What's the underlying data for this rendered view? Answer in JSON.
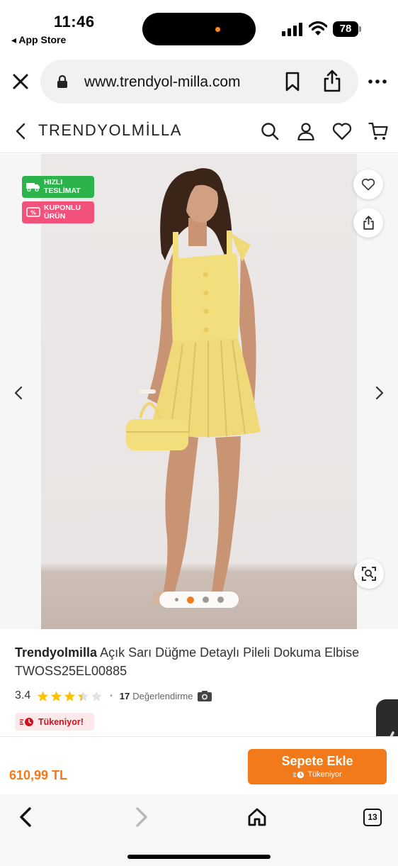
{
  "status_bar": {
    "time": "11:46",
    "back_app": "◂ App Store",
    "battery": "78"
  },
  "browser": {
    "url": "www.trendyol-milla.com",
    "icons": [
      "close-icon",
      "lock-icon",
      "bookmark-icon",
      "share-icon",
      "more-icon"
    ]
  },
  "site_header": {
    "logo": "TRENDYOLMİLLA",
    "icons": [
      "chevron-left-icon",
      "search-icon",
      "user-icon",
      "heart-icon",
      "cart-icon"
    ]
  },
  "gallery": {
    "badges": [
      {
        "line1": "HIZLI",
        "line2": "TESLİMAT",
        "color": "#2db34b",
        "icon": "truck-icon"
      },
      {
        "line1": "KUPONLU",
        "line2": "ÜRÜN",
        "color": "#f1517a",
        "icon": "coupon-icon"
      }
    ],
    "image_count": 4,
    "active_image": 1
  },
  "product": {
    "brand": "Trendyolmilla",
    "name": "Açık Sarı Düğme Detaylı Pileli Dokuma Elbise",
    "code": "TWOSS25EL00885",
    "rating": "3.4",
    "rating_value": 3.4,
    "review_count": "17",
    "review_label": "Değerlendirme",
    "stock_label": "Tükeniyor!"
  },
  "buy_bar": {
    "price": "610,99 TL",
    "button_label": "Sepete Ekle",
    "button_sub": "Tükeniyor"
  },
  "toolbar": {
    "tabs_count": "13"
  },
  "colors": {
    "brand_orange": "#f27a1a",
    "fast_delivery_green": "#2db34b",
    "coupon_pink": "#f1517a",
    "stock_red": "#d0101d",
    "star_yellow": "#ffc000"
  }
}
